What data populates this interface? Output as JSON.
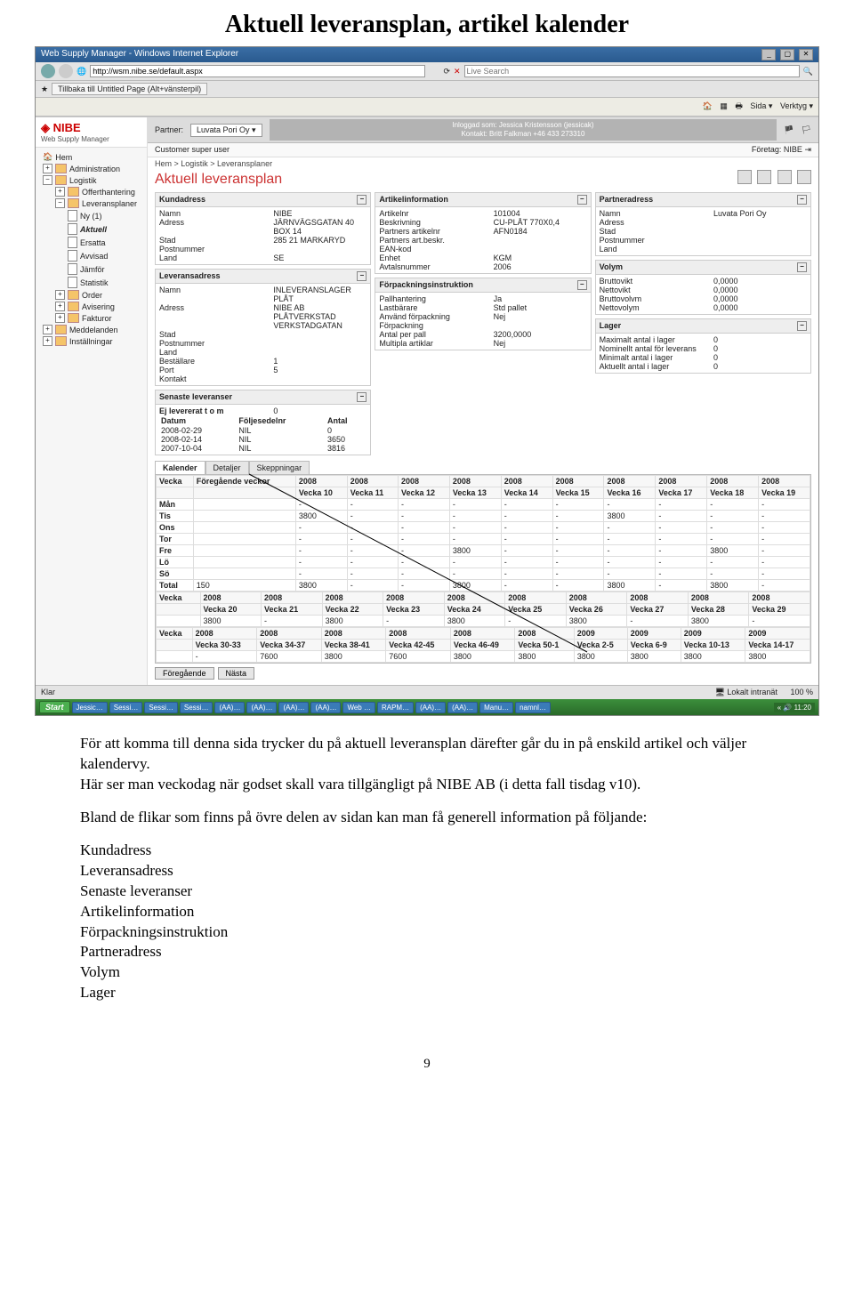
{
  "doc": {
    "title": "Aktuell leveransplan, artikel kalender",
    "para1": "För att komma till denna sida trycker du på aktuell leveransplan därefter går du in på enskild artikel och väljer kalendervy.",
    "para2": "Här ser man veckodag när godset skall vara tillgängligt på NIBE AB (i detta fall tisdag v10).",
    "para3": "Bland de flikar som finns på övre delen av sidan kan man få generell information på följande:",
    "list": [
      "Kundadress",
      "Leveransadress",
      "Senaste leveranser",
      "Artikelinformation",
      "Förpackningsinstruktion",
      "Partneradress",
      "Volym",
      "Lager"
    ],
    "page_number": "9"
  },
  "ie": {
    "title": "Web Supply Manager - Windows Internet Explorer",
    "url": "http://wsm.nibe.se/default.aspx",
    "search_placeholder": "Live Search",
    "tab": "Tillbaka till Untitled Page (Alt+vänsterpil)",
    "fav_right": [
      "Sida",
      "Verktyg"
    ],
    "status_left": "Klar",
    "status_right": "Lokalt intranät",
    "zoom": "100 %"
  },
  "app": {
    "brand": "NIBE",
    "brand_sub": "Web Supply Manager",
    "partner_label": "Partner:",
    "partner_value": "Luvata Pori Oy",
    "logged_line1": "Inloggad som: Jessica Kristensson (jessicak)",
    "logged_line2": "Kontakt: Britt Falkman +46 433 273310",
    "user_role": "Customer super user",
    "company_label": "Företag:",
    "company_value": "NIBE",
    "breadcrumb": "Hem > Logistik > Leveransplaner",
    "page_heading": "Aktuell leveransplan"
  },
  "tree": [
    {
      "lvl": 1,
      "icon": "home",
      "label": "Hem"
    },
    {
      "lvl": 1,
      "icon": "plus-folder",
      "label": "Administration"
    },
    {
      "lvl": 1,
      "icon": "minus-folder",
      "label": "Logistik"
    },
    {
      "lvl": 2,
      "icon": "plus-folder",
      "label": "Offerthantering"
    },
    {
      "lvl": 2,
      "icon": "minus-folder",
      "label": "Leveransplaner"
    },
    {
      "lvl": 3,
      "icon": "doc",
      "label": "Ny (1)"
    },
    {
      "lvl": 3,
      "icon": "doc",
      "label": "Aktuell",
      "bold": true
    },
    {
      "lvl": 3,
      "icon": "doc",
      "label": "Ersatta"
    },
    {
      "lvl": 3,
      "icon": "doc",
      "label": "Avvisad"
    },
    {
      "lvl": 3,
      "icon": "doc",
      "label": "Jämför"
    },
    {
      "lvl": 3,
      "icon": "doc",
      "label": "Statistik"
    },
    {
      "lvl": 2,
      "icon": "plus-folder",
      "label": "Order"
    },
    {
      "lvl": 2,
      "icon": "plus-folder",
      "label": "Avisering"
    },
    {
      "lvl": 2,
      "icon": "plus-folder",
      "label": "Fakturor"
    },
    {
      "lvl": 1,
      "icon": "plus-folder",
      "label": "Meddelanden"
    },
    {
      "lvl": 1,
      "icon": "plus-folder",
      "label": "Inställningar"
    }
  ],
  "panels": {
    "kund": {
      "title": "Kundadress",
      "rows": [
        [
          "Namn",
          "NIBE"
        ],
        [
          "Adress",
          "JÄRNVÄGSGATAN 40"
        ],
        [
          "",
          "BOX 14"
        ],
        [
          "Stad",
          "285 21 MARKARYD"
        ],
        [
          "Postnummer",
          ""
        ],
        [
          "Land",
          "SE"
        ]
      ]
    },
    "lev": {
      "title": "Leveransadress",
      "rows": [
        [
          "Namn",
          "INLEVERANSLAGER PLÅT"
        ],
        [
          "Adress",
          "NIBE AB PLÅTVERKSTAD"
        ],
        [
          "",
          "VERKSTADGATAN"
        ],
        [
          "Stad",
          ""
        ],
        [
          "Postnummer",
          ""
        ],
        [
          "Land",
          ""
        ],
        [
          "Beställare",
          "1"
        ],
        [
          "Port",
          "5"
        ],
        [
          "Kontakt",
          ""
        ]
      ]
    },
    "senaste": {
      "title": "Senaste leveranser",
      "ej_label": "Ej levererat t o m",
      "ej_value": "0",
      "headers": [
        "Datum",
        "Följesedelnr",
        "Antal"
      ],
      "rows": [
        [
          "2008-02-29",
          "NIL",
          "0"
        ],
        [
          "2008-02-14",
          "NIL",
          "3650"
        ],
        [
          "2007-10-04",
          "NIL",
          "3816"
        ]
      ]
    },
    "artikel": {
      "title": "Artikelinformation",
      "rows": [
        [
          "Artikelnr",
          "101004"
        ],
        [
          "Beskrivning",
          "CU-PLÅT 770X0,4"
        ],
        [
          "Partners artikelnr",
          "AFN0184"
        ],
        [
          "Partners art.beskr.",
          ""
        ],
        [
          "EAN-kod",
          ""
        ],
        [
          "Enhet",
          "KGM"
        ],
        [
          "Avtalsnummer",
          "2006"
        ]
      ]
    },
    "forpack": {
      "title": "Förpackningsinstruktion",
      "rows": [
        [
          "Pallhantering",
          "Ja"
        ],
        [
          "Lastbärare",
          "Std pallet"
        ],
        [
          "Använd förpackning",
          "Nej"
        ],
        [
          "Förpackning",
          ""
        ],
        [
          "Antal per pall",
          "3200,0000"
        ],
        [
          "Multipla artiklar",
          "Nej"
        ]
      ]
    },
    "partner": {
      "title": "Partneradress",
      "rows": [
        [
          "Namn",
          "Luvata Pori Oy"
        ],
        [
          "Adress",
          ""
        ],
        [
          "Stad",
          ""
        ],
        [
          "Postnummer",
          ""
        ],
        [
          "Land",
          ""
        ]
      ]
    },
    "volym": {
      "title": "Volym",
      "rows": [
        [
          "Bruttovikt",
          "0,0000"
        ],
        [
          "Nettovikt",
          "0,0000"
        ],
        [
          "Bruttovolvm",
          "0,0000"
        ],
        [
          "Nettovolym",
          "0,0000"
        ]
      ]
    },
    "lager": {
      "title": "Lager",
      "rows": [
        [
          "Maximalt antal i lager",
          "0"
        ],
        [
          "Nominellt antal för leverans",
          "0"
        ],
        [
          "Minimalt antal i lager",
          "0"
        ],
        [
          "Aktuellt antal i lager",
          "0"
        ]
      ]
    }
  },
  "subtabs": [
    "Kalender",
    "Detaljer",
    "Skeppningar"
  ],
  "calendar": {
    "block1": {
      "year_row": [
        "Vecka",
        "Föregående veckor",
        "2008",
        "2008",
        "2008",
        "2008",
        "2008",
        "2008",
        "2008",
        "2008",
        "2008",
        "2008"
      ],
      "week_row": [
        "",
        "",
        "Vecka 10",
        "Vecka 11",
        "Vecka 12",
        "Vecka 13",
        "Vecka 14",
        "Vecka 15",
        "Vecka 16",
        "Vecka 17",
        "Vecka 18",
        "Vecka 19"
      ],
      "days": [
        [
          "Mån",
          "",
          "-",
          "-",
          "-",
          "-",
          "-",
          "-",
          "-",
          "-",
          "-",
          "-"
        ],
        [
          "Tis",
          "",
          "3800",
          "-",
          "-",
          "-",
          "-",
          "-",
          "3800",
          "-",
          "-",
          "-"
        ],
        [
          "Ons",
          "",
          "-",
          "-",
          "-",
          "-",
          "-",
          "-",
          "-",
          "-",
          "-",
          "-"
        ],
        [
          "Tor",
          "",
          "-",
          "-",
          "-",
          "-",
          "-",
          "-",
          "-",
          "-",
          "-",
          "-"
        ],
        [
          "Fre",
          "",
          "-",
          "-",
          "-",
          "3800",
          "-",
          "-",
          "-",
          "-",
          "3800",
          "-"
        ],
        [
          "Lö",
          "",
          "-",
          "-",
          "-",
          "-",
          "-",
          "-",
          "-",
          "-",
          "-",
          "-"
        ],
        [
          "Sö",
          "",
          "-",
          "-",
          "-",
          "-",
          "-",
          "-",
          "-",
          "-",
          "-",
          "-"
        ],
        [
          "Total",
          "150",
          "3800",
          "-",
          "-",
          "3800",
          "-",
          "-",
          "3800",
          "-",
          "3800",
          "-"
        ]
      ]
    },
    "block2": {
      "year_row": [
        "Vecka",
        "2008",
        "2008",
        "2008",
        "2008",
        "2008",
        "2008",
        "2008",
        "2008",
        "2008",
        "2008"
      ],
      "week_row": [
        "",
        "Vecka 20",
        "Vecka 21",
        "Vecka 22",
        "Vecka 23",
        "Vecka 24",
        "Vecka 25",
        "Vecka 26",
        "Vecka 27",
        "Vecka 28",
        "Vecka 29"
      ],
      "rows": [
        [
          "",
          "3800",
          "-",
          "3800",
          "-",
          "3800",
          "-",
          "3800",
          "-",
          "3800",
          "-"
        ]
      ]
    },
    "block3": {
      "year_row": [
        "Vecka",
        "2008",
        "2008",
        "2008",
        "2008",
        "2008",
        "2008",
        "2009",
        "2009",
        "2009",
        "2009"
      ],
      "week_row": [
        "",
        "Vecka 30-33",
        "Vecka 34-37",
        "Vecka 38-41",
        "Vecka 42-45",
        "Vecka 46-49",
        "Vecka 50-1",
        "Vecka 2-5",
        "Vecka 6-9",
        "Vecka 10-13",
        "Vecka 14-17"
      ],
      "rows": [
        [
          "",
          "-",
          "7600",
          "3800",
          "7600",
          "3800",
          "3800",
          "3800",
          "3800",
          "3800",
          "3800"
        ]
      ]
    },
    "nav": [
      "Föregående",
      "Nästa"
    ]
  },
  "taskbar": {
    "start": "Start",
    "items": [
      "Jessic…",
      "Sessi…",
      "Sessi…",
      "Sessi…",
      "(AA)…",
      "(AA)…",
      "(AA)…",
      "(AA)…",
      "Web …",
      "RAPM…",
      "(AA)…",
      "(AA)…",
      "Manu…",
      "namnl…"
    ],
    "time": "11:20"
  }
}
